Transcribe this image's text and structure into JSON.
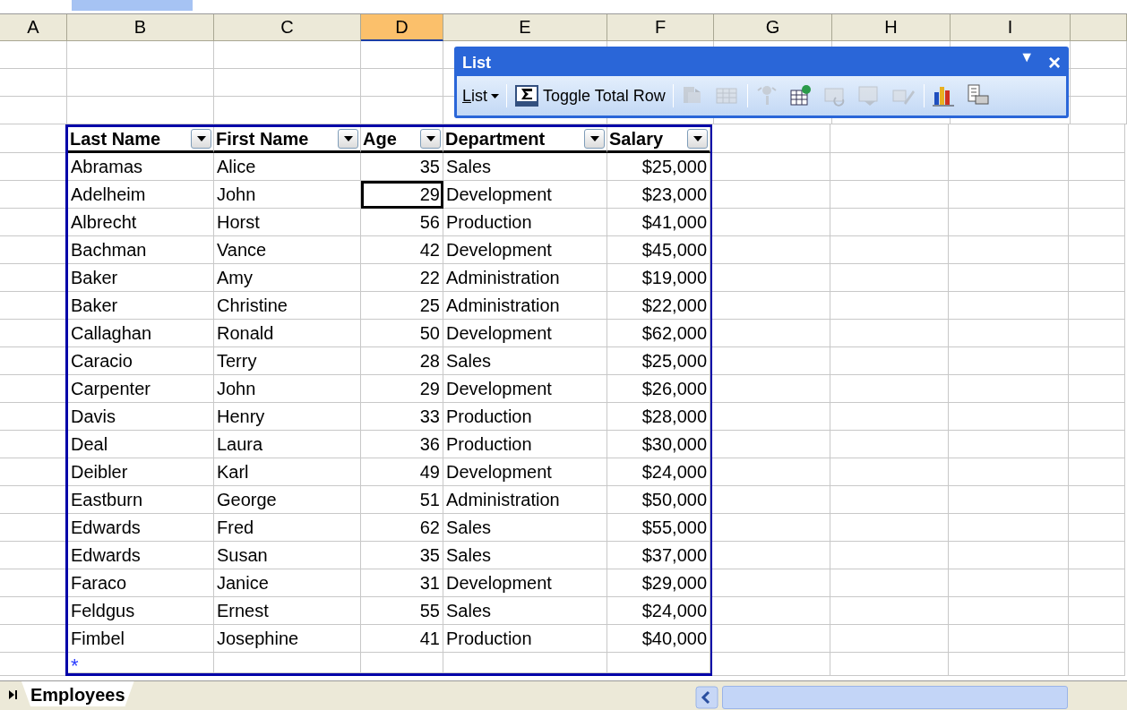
{
  "column_headers": [
    {
      "label": "A",
      "selected": false
    },
    {
      "label": "B",
      "selected": false
    },
    {
      "label": "C",
      "selected": false
    },
    {
      "label": "D",
      "selected": true
    },
    {
      "label": "E",
      "selected": false
    },
    {
      "label": "F",
      "selected": false
    },
    {
      "label": "G",
      "selected": false
    },
    {
      "label": "H",
      "selected": false
    },
    {
      "label": "I",
      "selected": false
    }
  ],
  "list": {
    "columns": [
      {
        "label": "Last Name",
        "kind": "text"
      },
      {
        "label": "First Name",
        "kind": "text"
      },
      {
        "label": "Age",
        "kind": "number"
      },
      {
        "label": "Department",
        "kind": "text"
      },
      {
        "label": "Salary",
        "kind": "number"
      }
    ],
    "rows": [
      {
        "cells": [
          "Abramas",
          "Alice",
          "35",
          "Sales",
          "$25,000"
        ],
        "selected": false
      },
      {
        "cells": [
          "Adelheim",
          "John",
          "29",
          "Development",
          "$23,000"
        ],
        "selected": true
      },
      {
        "cells": [
          "Albrecht",
          "Horst",
          "56",
          "Production",
          "$41,000"
        ],
        "selected": false
      },
      {
        "cells": [
          "Bachman",
          "Vance",
          "42",
          "Development",
          "$45,000"
        ],
        "selected": false
      },
      {
        "cells": [
          "Baker",
          "Amy",
          "22",
          "Administration",
          "$19,000"
        ],
        "selected": false
      },
      {
        "cells": [
          "Baker",
          "Christine",
          "25",
          "Administration",
          "$22,000"
        ],
        "selected": false
      },
      {
        "cells": [
          "Callaghan",
          "Ronald",
          "50",
          "Development",
          "$62,000"
        ],
        "selected": false
      },
      {
        "cells": [
          "Caracio",
          "Terry",
          "28",
          "Sales",
          "$25,000"
        ],
        "selected": false
      },
      {
        "cells": [
          "Carpenter",
          "John",
          "29",
          "Development",
          "$26,000"
        ],
        "selected": false
      },
      {
        "cells": [
          "Davis",
          "Henry",
          "33",
          "Production",
          "$28,000"
        ],
        "selected": false
      },
      {
        "cells": [
          "Deal",
          "Laura",
          "36",
          "Production",
          "$30,000"
        ],
        "selected": false
      },
      {
        "cells": [
          "Deibler",
          "Karl",
          "49",
          "Development",
          "$24,000"
        ],
        "selected": false
      },
      {
        "cells": [
          "Eastburn",
          "George",
          "51",
          "Administration",
          "$50,000"
        ],
        "selected": false
      },
      {
        "cells": [
          "Edwards",
          "Fred",
          "62",
          "Sales",
          "$55,000"
        ],
        "selected": false
      },
      {
        "cells": [
          "Edwards",
          "Susan",
          "35",
          "Sales",
          "$37,000"
        ],
        "selected": false
      },
      {
        "cells": [
          "Faraco",
          "Janice",
          "31",
          "Development",
          "$29,000"
        ],
        "selected": false
      },
      {
        "cells": [
          "Feldgus",
          "Ernest",
          "55",
          "Sales",
          "$24,000"
        ],
        "selected": false
      },
      {
        "cells": [
          "Fimbel",
          "Josephine",
          "41",
          "Production",
          "$40,000"
        ],
        "selected": false
      }
    ],
    "new_row_marker": "*"
  },
  "list_toolbar": {
    "title": "List",
    "options_glyph": "▼",
    "close_glyph": "×",
    "items": [
      {
        "kind": "menu",
        "label": "List"
      },
      {
        "kind": "separator"
      },
      {
        "kind": "button",
        "label": "Toggle Total Row"
      },
      {
        "kind": "separator"
      },
      {
        "kind": "icon",
        "disabled": true
      },
      {
        "kind": "icon",
        "disabled": true
      },
      {
        "kind": "separator"
      },
      {
        "kind": "icon",
        "disabled": true
      },
      {
        "kind": "icon",
        "disabled": false
      },
      {
        "kind": "icon",
        "disabled": true
      },
      {
        "kind": "icon",
        "disabled": true
      },
      {
        "kind": "icon",
        "disabled": true
      },
      {
        "kind": "separator"
      },
      {
        "kind": "icon",
        "disabled": false
      },
      {
        "kind": "icon",
        "disabled": false
      }
    ]
  },
  "sheet_tabs": [
    {
      "label": "Employees",
      "selected": true
    }
  ]
}
